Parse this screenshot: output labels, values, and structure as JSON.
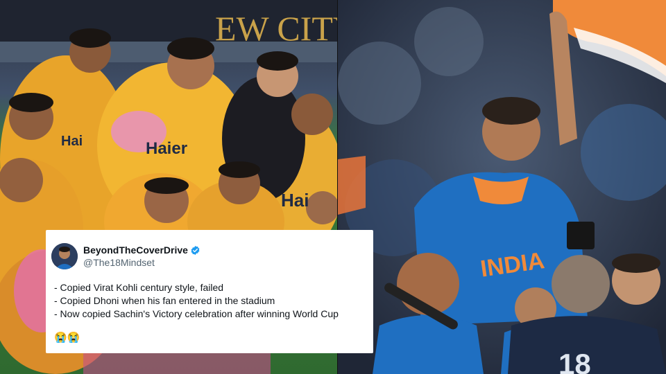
{
  "tweet": {
    "display_name": "BeyondTheCoverDrive",
    "handle": "@The18Mindset",
    "lines": [
      "- Copied Virat Kohli century style, failed",
      "- Copied Dhoni when his fan entered in the stadium",
      "- Now copied Sachin's Victory celebration after winning World Cup"
    ],
    "emojis": "😭😭"
  },
  "left_photo": {
    "stadium_sign": "EW CITY",
    "jersey_text_1": "Haier",
    "jersey_text_2": "Hai",
    "jersey_text_3": "Hai"
  },
  "right_photo": {
    "jersey_text": "INDIA",
    "back_number": "18"
  },
  "colors": {
    "peshawar_yellow": "#f2b632",
    "india_blue": "#1f6fc1",
    "tweet_bg": "#ffffff",
    "verified_blue": "#1d9bf0"
  }
}
